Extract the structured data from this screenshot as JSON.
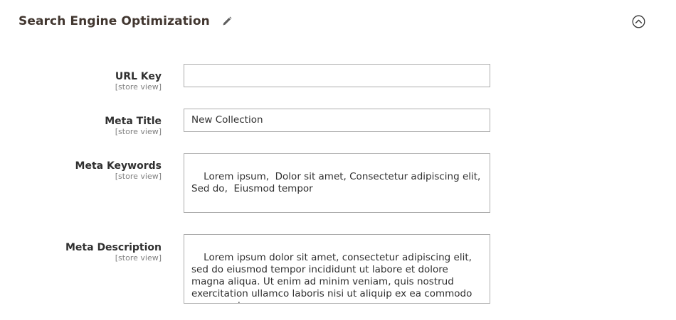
{
  "section": {
    "title": "Search Engine Optimization",
    "edit_icon": "pencil-icon",
    "collapse_icon": "chevron-up-circle-icon"
  },
  "fields": {
    "url_key": {
      "label": "URL Key",
      "scope": "[store view]",
      "value": ""
    },
    "meta_title": {
      "label": "Meta Title",
      "scope": "[store view]",
      "value": "New Collection"
    },
    "meta_keywords": {
      "label": "Meta Keywords",
      "scope": "[store view]",
      "value": "Lorem ipsum,  Dolor sit amet, Consectetur adipiscing elit, Sed do,  Eiusmod tempor"
    },
    "meta_description": {
      "label": "Meta Description",
      "scope": "[store view]",
      "value": "Lorem ipsum dolor sit amet, consectetur adipiscing elit, sed do eiusmod tempor incididunt ut labore et dolore magna aliqua. Ut enim ad minim veniam, quis nostrud exercitation ullamco laboris nisi ut aliquip ex ea commodo consequat."
    }
  },
  "colors": {
    "title": "#41362f",
    "label": "#303030",
    "scope": "#808080",
    "border": "#adadad"
  }
}
